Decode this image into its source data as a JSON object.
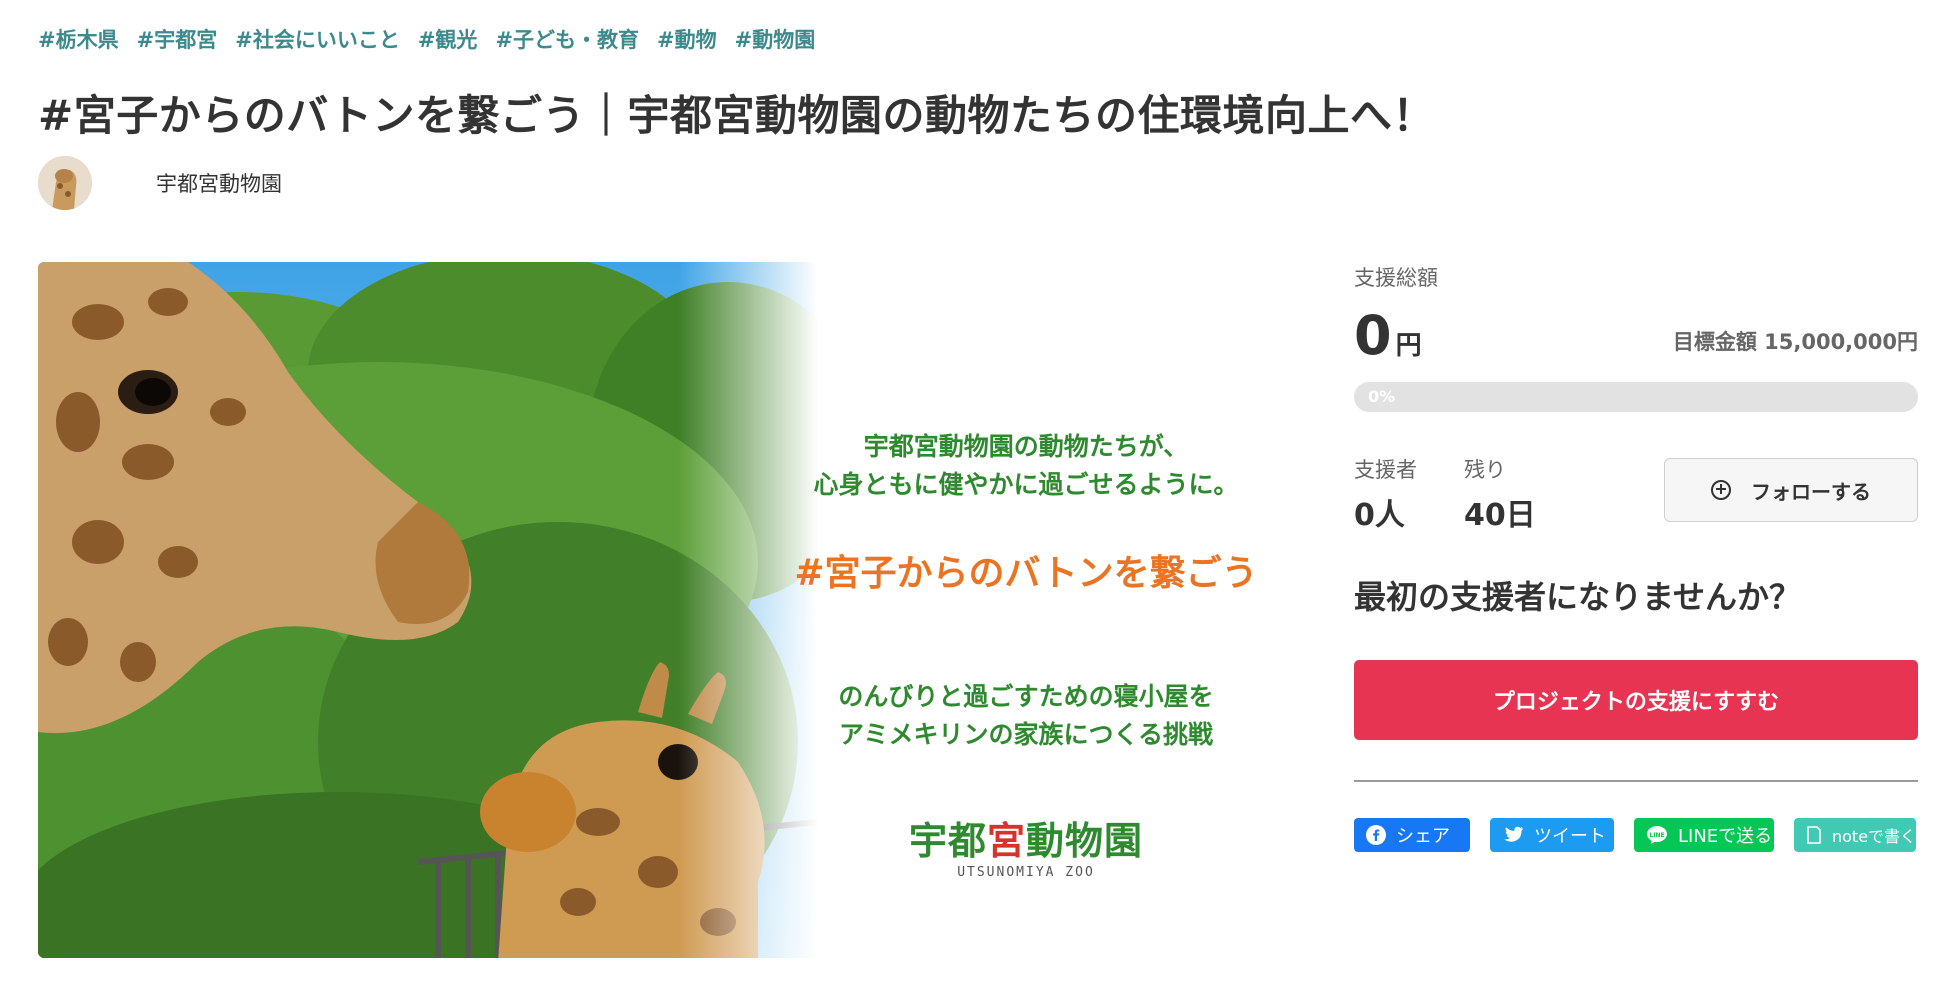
{
  "tags": [
    "#栃木県",
    "#宇都宮",
    "#社会にいいこと",
    "#観光",
    "#子ども・教育",
    "#動物",
    "#動物園"
  ],
  "title": "#宮子からのバトンを繋ごう｜宇都宮動物園の動物たちの住環境向上へ！",
  "owner": {
    "name": "宇都宮動物園",
    "avatar_icon": "giraffe-avatar"
  },
  "hero": {
    "line1": "宇都宮動物園の動物たちが、",
    "line2": "心身ともに健やかに過ごせるように。",
    "hashtag": "#宮子からのバトンを繋ごう",
    "line3": "のんびりと過ごすための寝小屋を",
    "line4": "アミメキリンの家族につくる挑戦",
    "logo_pre": "宇都",
    "logo_red": "宮",
    "logo_post": "動物園",
    "logo_sub": "UTSUNOMIYA ZOO"
  },
  "funding": {
    "total_label": "支援総額",
    "amount": "0",
    "unit": "円",
    "goal_text": "目標金額 15,000,000円",
    "progress_text": "0%",
    "progress_fraction": 0,
    "backers_label": "支援者",
    "backers_value": "0人",
    "remaining_label": "残り",
    "remaining_value": "40日"
  },
  "follow_label": "フォローする",
  "first_backer_text": "最初の支援者になりませんか？",
  "support_button": "プロジェクトの支援にすすむ",
  "share": {
    "facebook": "シェア",
    "twitter": "ツイート",
    "line": "LINEで送る",
    "note": "noteで書く"
  },
  "colors": {
    "tag": "#3d8a8d",
    "support": "#e63452",
    "facebook": "#1877f2",
    "twitter": "#1d9bf0",
    "line": "#06c755",
    "note": "#41c9b4"
  }
}
